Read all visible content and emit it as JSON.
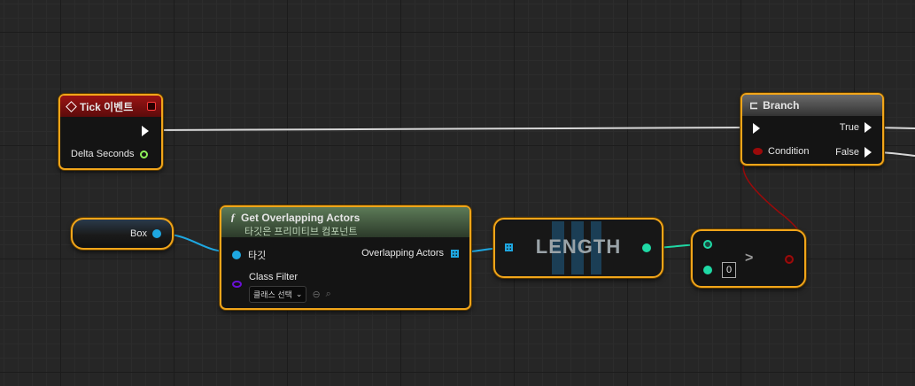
{
  "tick_node": {
    "title": "Tick 이벤트",
    "pin_delta": "Delta Seconds",
    "header_color": "#7a1010"
  },
  "branch_node": {
    "title": "Branch",
    "pin_condition": "Condition",
    "pin_true": "True",
    "pin_false": "False"
  },
  "box_node": {
    "label": "Box"
  },
  "overlap_node": {
    "title": "Get Overlapping Actors",
    "subtitle": "타깃은 프리미티브 컴포넌트",
    "pin_target": "타깃",
    "pin_out": "Overlapping Actors",
    "pin_class_filter": "Class Filter",
    "class_select": "클래스 선택",
    "header_color": "#4e6b4a"
  },
  "length_node": {
    "label": "LENGTH"
  },
  "compare_node": {
    "operator": ">",
    "input_b": "0"
  },
  "colors": {
    "node_border": "#f1a51a",
    "exec_wire": "#d8d8d8",
    "object_pin": "#1ea7e1",
    "int_pin": "#1fd9a5",
    "bool_pin": "#9b0a0a",
    "class_pin": "#6a0fd8"
  }
}
